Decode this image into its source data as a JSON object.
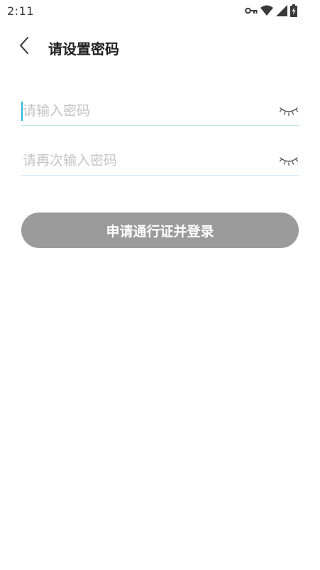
{
  "status_bar": {
    "time": "2:11",
    "icons": [
      "key-icon",
      "wifi-icon",
      "cell-signal-icon",
      "battery-charging-icon"
    ]
  },
  "header": {
    "back_icon": "chevron-left-icon",
    "title": "请设置密码"
  },
  "form": {
    "password_field": {
      "placeholder": "请输入密码",
      "value": "",
      "toggle_icon": "eye-closed-icon"
    },
    "confirm_field": {
      "placeholder": "请再次输入密码",
      "value": "",
      "toggle_icon": "eye-closed-icon"
    },
    "submit_label": "申请通行证并登录"
  },
  "colors": {
    "accent": "#2bb7e0",
    "underline": "#bfe6ef",
    "button_disabled": "#9b9b9b",
    "placeholder": "#c4c4c4"
  }
}
